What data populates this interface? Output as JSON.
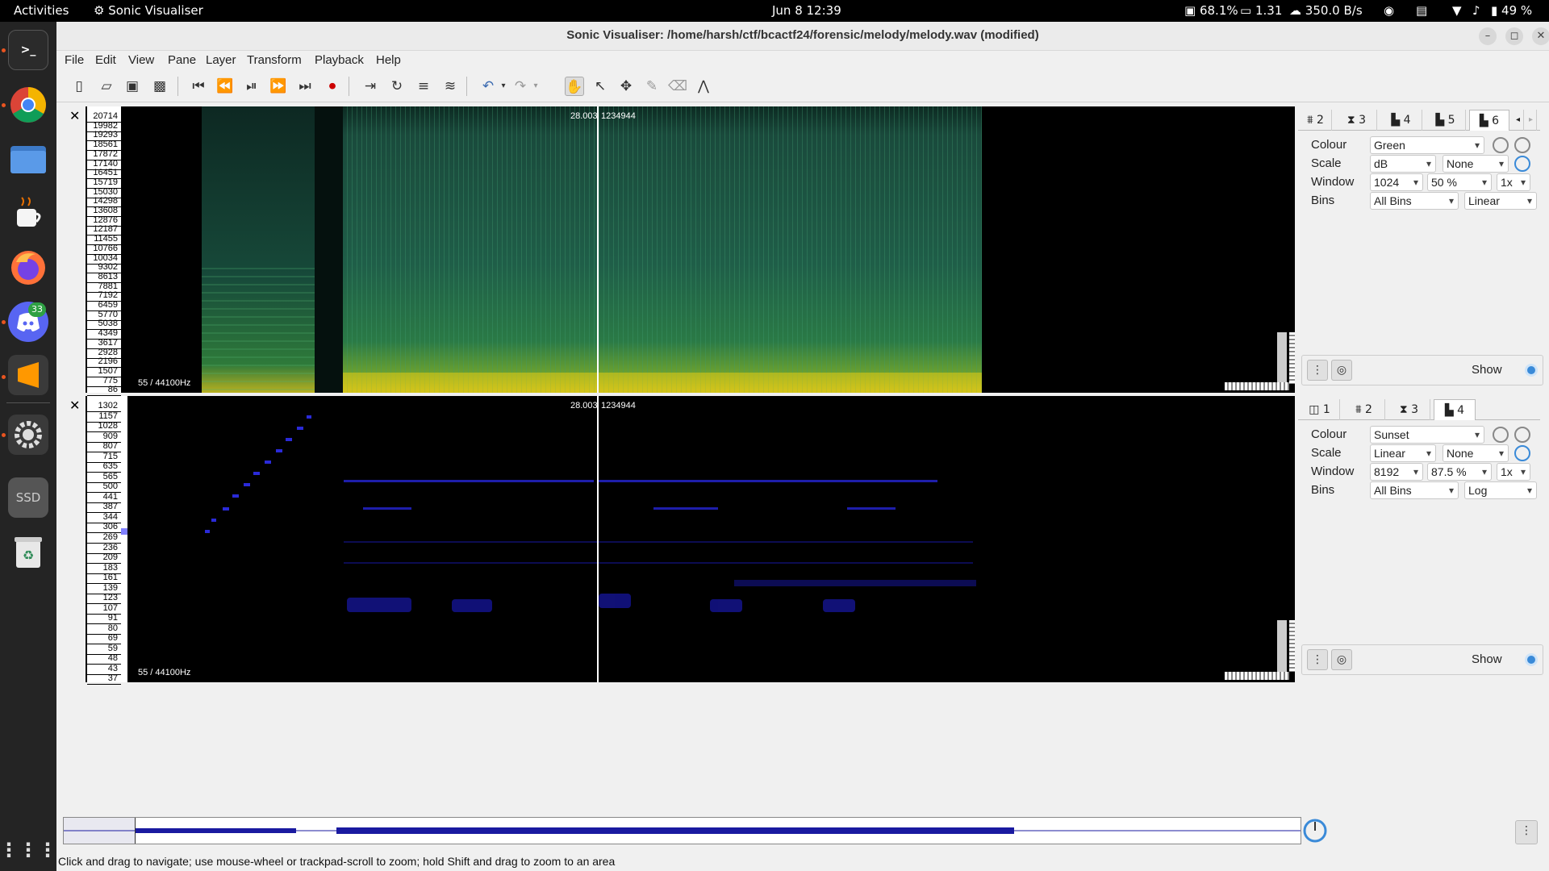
{
  "topbar": {
    "activities": "Activities",
    "app_name": "Sonic Visualiser",
    "datetime": "Jun 8  12:39",
    "cpu": "68.1%",
    "load": "1.31",
    "net": "350.0 B/s",
    "battery": "49 %"
  },
  "dock": {
    "discord_badge": "33",
    "ssd_label": "SSD"
  },
  "window": {
    "title": "Sonic Visualiser: /home/harsh/ctf/bcactf24/forensic/melody/melody.wav (modified)"
  },
  "menu": [
    "File",
    "Edit",
    "View",
    "Pane",
    "Layer",
    "Transform",
    "Playback",
    "Help"
  ],
  "pane1": {
    "ruler": [
      "20714",
      "19982",
      "19293",
      "18561",
      "17872",
      "17140",
      "16451",
      "15719",
      "15030",
      "14298",
      "13608",
      "12876",
      "12187",
      "11455",
      "10766",
      "10034",
      "9302",
      "8613",
      "7881",
      "7192",
      "6459",
      "5770",
      "5038",
      "4349",
      "3617",
      "2928",
      "2196",
      "1507",
      "775",
      "86"
    ],
    "rate": "55 / 44100Hz",
    "cursor_time": "28.003",
    "cursor_frame": "1234944",
    "tabs": [
      "2",
      "3",
      "4",
      "5",
      "6"
    ],
    "colour_label": "Colour",
    "colour": "Green",
    "scale_label": "Scale",
    "scale": "dB",
    "scale2": "None",
    "window_label": "Window",
    "window": "1024",
    "overlap": "50 %",
    "zoom": "1x",
    "bins_label": "Bins",
    "bins": "All Bins",
    "bins2": "Linear",
    "show": "Show"
  },
  "pane2": {
    "ruler": [
      "1302",
      "1157",
      "1028",
      "909",
      "807",
      "715",
      "635",
      "565",
      "500",
      "441",
      "387",
      "344",
      "306",
      "269",
      "236",
      "209",
      "183",
      "161",
      "139",
      "123",
      "107",
      "91",
      "80",
      "69",
      "59",
      "48",
      "43",
      "37"
    ],
    "rate": "55 / 44100Hz",
    "cursor_time": "28.003",
    "cursor_frame": "1234944",
    "tabs": [
      "1",
      "2",
      "3",
      "4"
    ],
    "colour_label": "Colour",
    "colour": "Sunset",
    "scale_label": "Scale",
    "scale": "Linear",
    "scale2": "None",
    "window_label": "Window",
    "window": "8192",
    "overlap": "87.5 %",
    "zoom": "1x",
    "bins_label": "Bins",
    "bins": "All Bins",
    "bins2": "Log",
    "show": "Show"
  },
  "status": "Click and drag to navigate; use mouse-wheel or trackpad-scroll to zoom; hold Shift and drag to zoom to an area",
  "colors": {
    "spec_green": "#1e6a4e",
    "spec_yellow": "#c8c020",
    "note_blue": "#2828d8",
    "accent": "#e95420"
  }
}
